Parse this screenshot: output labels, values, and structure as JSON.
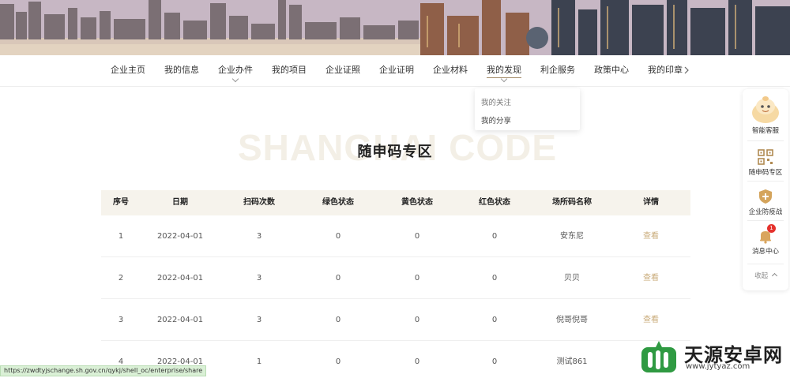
{
  "colors": {
    "accent": "#a38a66",
    "header_bg": "#f6f3ec",
    "link": "#c9ab7a",
    "badge": "#e5322d"
  },
  "nav": {
    "items": [
      {
        "label": "企业主页",
        "dropdown": false
      },
      {
        "label": "我的信息",
        "dropdown": false
      },
      {
        "label": "企业办件",
        "dropdown": true
      },
      {
        "label": "我的项目",
        "dropdown": false
      },
      {
        "label": "企业证照",
        "dropdown": false
      },
      {
        "label": "企业证明",
        "dropdown": false
      },
      {
        "label": "企业材料",
        "dropdown": false
      },
      {
        "label": "我的发现",
        "dropdown": true,
        "active": true
      },
      {
        "label": "利企服务",
        "dropdown": false
      },
      {
        "label": "政策中心",
        "dropdown": false
      },
      {
        "label": "我的印章",
        "dropdown": false
      }
    ],
    "dropdown_items": [
      "我的关注",
      "我的分享"
    ]
  },
  "heading": {
    "bg_text": "SHANGHAI CODE",
    "title": "随申码专区"
  },
  "table": {
    "headers": [
      "序号",
      "日期",
      "扫码次数",
      "绿色状态",
      "黄色状态",
      "红色状态",
      "场所码名称",
      "详情"
    ],
    "rows": [
      [
        "1",
        "2022-04-01",
        "3",
        "0",
        "0",
        "0",
        "安东尼",
        "查看"
      ],
      [
        "2",
        "2022-04-01",
        "3",
        "0",
        "0",
        "0",
        "贝贝",
        "查看"
      ],
      [
        "3",
        "2022-04-01",
        "3",
        "0",
        "0",
        "0",
        "倪哥倪哥",
        "查看"
      ],
      [
        "4",
        "2022-04-01",
        "1",
        "0",
        "0",
        "0",
        "测试861",
        ""
      ]
    ]
  },
  "sidebar": {
    "items": [
      {
        "label": "智能客服",
        "icon": "robot-assistant-icon"
      },
      {
        "label": "随申码专区",
        "icon": "qr-code-icon"
      },
      {
        "label": "企业防疫战",
        "icon": "shield-icon"
      },
      {
        "label": "消息中心",
        "icon": "bell-icon",
        "badge": "1"
      }
    ],
    "collapse_label": "收起"
  },
  "status_url": "https://zwdtyjschange.sh.gov.cn/qykj/shell_oc/enterprise/share",
  "watermark": {
    "name": "天源安卓网",
    "url": "www.jytyaz.com"
  }
}
